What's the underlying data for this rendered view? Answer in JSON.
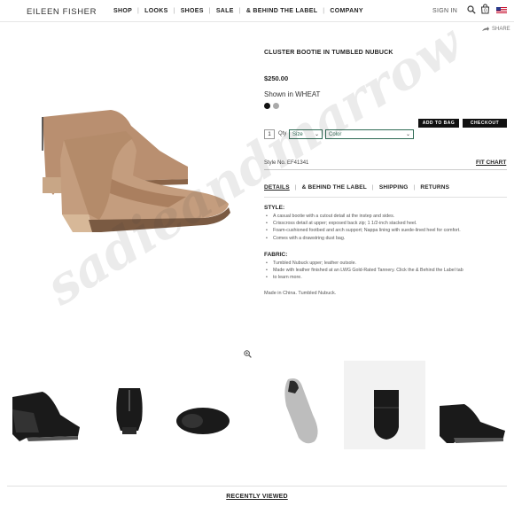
{
  "header": {
    "logo": "EILEEN FISHER",
    "nav": [
      "SHOP",
      "LOOKS",
      "SHOES",
      "SALE",
      "& BEHIND THE LABEL",
      "COMPANY"
    ],
    "signin": "SIGN IN",
    "icons": [
      "search-icon",
      "bag-icon",
      "us-flag-icon"
    ]
  },
  "share": {
    "label": "SHARE",
    "icon": "share-arrow-icon"
  },
  "product": {
    "title": "CLUSTER BOOTIE IN TUMBLED NUBUCK",
    "price": "$250.00",
    "shown_in": "Shown in WHEAT",
    "swatch_colors": [
      "#111111",
      "#a9a9a9"
    ],
    "add_to_bag": "ADD TO BAG",
    "checkout": "CHECKOUT",
    "qty_value": "1",
    "qty_label": "Qty",
    "size_select": "Size",
    "color_select": "Color",
    "style_no": "Style No. EF41341",
    "fit_chart": "FIT CHART",
    "image_color": "#c29a7b"
  },
  "tabs": [
    "DETAILS",
    "& BEHIND THE LABEL",
    "SHIPPING",
    "RETURNS"
  ],
  "details": {
    "style_heading": "STYLE:",
    "style_bullets": [
      "A casual bootie with a cutout detail at the instep and sides.",
      "Crisscross detail at upper; exposed back zip; 1 1/2-inch stacked heel.",
      "Foam-cushioned footbed and arch support; Nappa lining with suede-lined heel for comfort.",
      "Comes with a drawstring dust bag."
    ],
    "fabric_heading": "FABRIC:",
    "fabric_bullets": [
      "Tumbled Nubuck upper; leather outsole.",
      "Made with leather finished at an LWG Gold-Rated Tannery. Click the & Behind the Label tab",
      "to learn more."
    ],
    "made_in": "Made in China. Tumbled Nubuck."
  },
  "thumbnails": [
    "side-view",
    "back-view",
    "top-view",
    "sole-view",
    "front-view",
    "profile-view"
  ],
  "thumb_color": "#1a1a1a",
  "recently_viewed": "RECENTLY VIEWED",
  "watermark": "sadieandmarrow"
}
